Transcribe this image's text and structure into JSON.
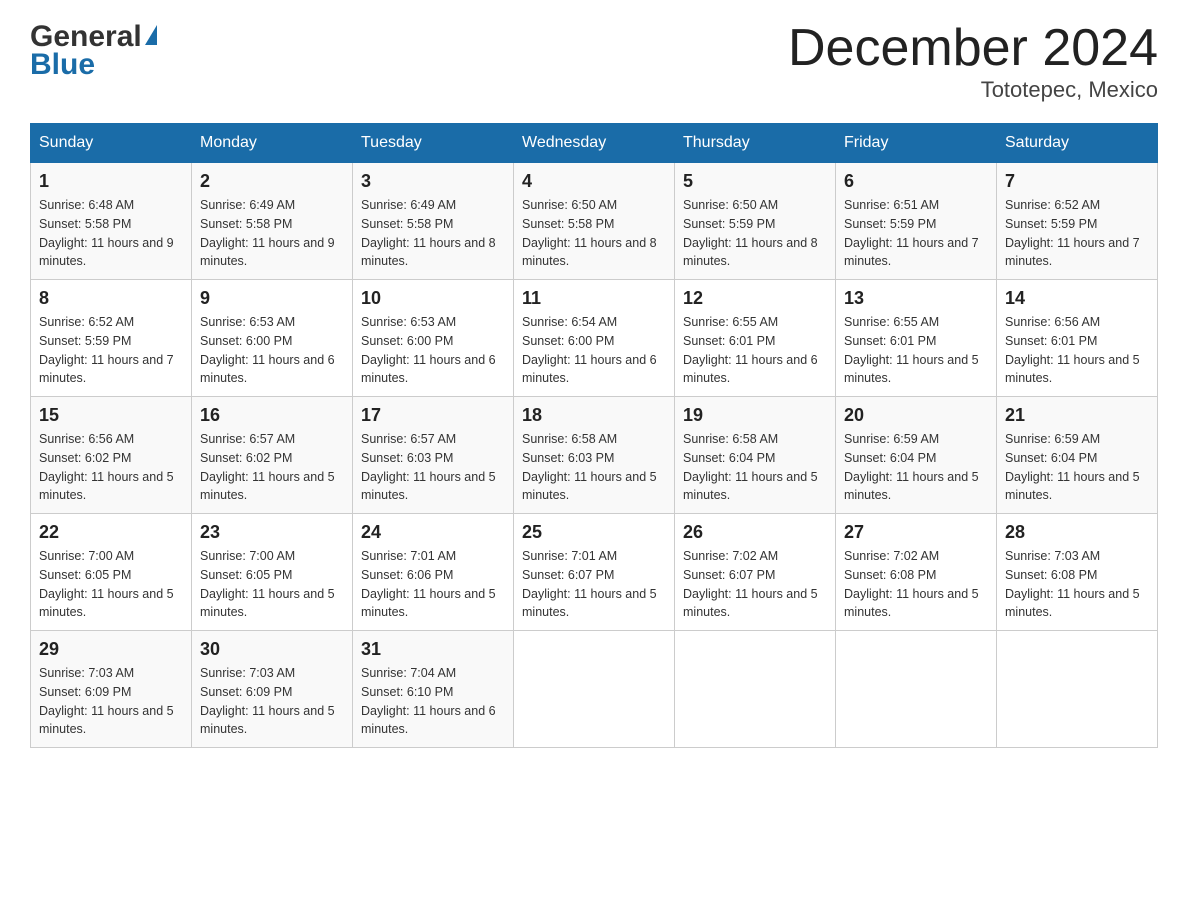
{
  "header": {
    "logo": {
      "top": "General",
      "bottom": "Blue"
    },
    "title": "December 2024",
    "subtitle": "Tototepec, Mexico"
  },
  "days_of_week": [
    "Sunday",
    "Monday",
    "Tuesday",
    "Wednesday",
    "Thursday",
    "Friday",
    "Saturday"
  ],
  "weeks": [
    [
      {
        "date": "1",
        "sunrise": "6:48 AM",
        "sunset": "5:58 PM",
        "daylight": "11 hours and 9 minutes."
      },
      {
        "date": "2",
        "sunrise": "6:49 AM",
        "sunset": "5:58 PM",
        "daylight": "11 hours and 9 minutes."
      },
      {
        "date": "3",
        "sunrise": "6:49 AM",
        "sunset": "5:58 PM",
        "daylight": "11 hours and 8 minutes."
      },
      {
        "date": "4",
        "sunrise": "6:50 AM",
        "sunset": "5:58 PM",
        "daylight": "11 hours and 8 minutes."
      },
      {
        "date": "5",
        "sunrise": "6:50 AM",
        "sunset": "5:59 PM",
        "daylight": "11 hours and 8 minutes."
      },
      {
        "date": "6",
        "sunrise": "6:51 AM",
        "sunset": "5:59 PM",
        "daylight": "11 hours and 7 minutes."
      },
      {
        "date": "7",
        "sunrise": "6:52 AM",
        "sunset": "5:59 PM",
        "daylight": "11 hours and 7 minutes."
      }
    ],
    [
      {
        "date": "8",
        "sunrise": "6:52 AM",
        "sunset": "5:59 PM",
        "daylight": "11 hours and 7 minutes."
      },
      {
        "date": "9",
        "sunrise": "6:53 AM",
        "sunset": "6:00 PM",
        "daylight": "11 hours and 6 minutes."
      },
      {
        "date": "10",
        "sunrise": "6:53 AM",
        "sunset": "6:00 PM",
        "daylight": "11 hours and 6 minutes."
      },
      {
        "date": "11",
        "sunrise": "6:54 AM",
        "sunset": "6:00 PM",
        "daylight": "11 hours and 6 minutes."
      },
      {
        "date": "12",
        "sunrise": "6:55 AM",
        "sunset": "6:01 PM",
        "daylight": "11 hours and 6 minutes."
      },
      {
        "date": "13",
        "sunrise": "6:55 AM",
        "sunset": "6:01 PM",
        "daylight": "11 hours and 5 minutes."
      },
      {
        "date": "14",
        "sunrise": "6:56 AM",
        "sunset": "6:01 PM",
        "daylight": "11 hours and 5 minutes."
      }
    ],
    [
      {
        "date": "15",
        "sunrise": "6:56 AM",
        "sunset": "6:02 PM",
        "daylight": "11 hours and 5 minutes."
      },
      {
        "date": "16",
        "sunrise": "6:57 AM",
        "sunset": "6:02 PM",
        "daylight": "11 hours and 5 minutes."
      },
      {
        "date": "17",
        "sunrise": "6:57 AM",
        "sunset": "6:03 PM",
        "daylight": "11 hours and 5 minutes."
      },
      {
        "date": "18",
        "sunrise": "6:58 AM",
        "sunset": "6:03 PM",
        "daylight": "11 hours and 5 minutes."
      },
      {
        "date": "19",
        "sunrise": "6:58 AM",
        "sunset": "6:04 PM",
        "daylight": "11 hours and 5 minutes."
      },
      {
        "date": "20",
        "sunrise": "6:59 AM",
        "sunset": "6:04 PM",
        "daylight": "11 hours and 5 minutes."
      },
      {
        "date": "21",
        "sunrise": "6:59 AM",
        "sunset": "6:04 PM",
        "daylight": "11 hours and 5 minutes."
      }
    ],
    [
      {
        "date": "22",
        "sunrise": "7:00 AM",
        "sunset": "6:05 PM",
        "daylight": "11 hours and 5 minutes."
      },
      {
        "date": "23",
        "sunrise": "7:00 AM",
        "sunset": "6:05 PM",
        "daylight": "11 hours and 5 minutes."
      },
      {
        "date": "24",
        "sunrise": "7:01 AM",
        "sunset": "6:06 PM",
        "daylight": "11 hours and 5 minutes."
      },
      {
        "date": "25",
        "sunrise": "7:01 AM",
        "sunset": "6:07 PM",
        "daylight": "11 hours and 5 minutes."
      },
      {
        "date": "26",
        "sunrise": "7:02 AM",
        "sunset": "6:07 PM",
        "daylight": "11 hours and 5 minutes."
      },
      {
        "date": "27",
        "sunrise": "7:02 AM",
        "sunset": "6:08 PM",
        "daylight": "11 hours and 5 minutes."
      },
      {
        "date": "28",
        "sunrise": "7:03 AM",
        "sunset": "6:08 PM",
        "daylight": "11 hours and 5 minutes."
      }
    ],
    [
      {
        "date": "29",
        "sunrise": "7:03 AM",
        "sunset": "6:09 PM",
        "daylight": "11 hours and 5 minutes."
      },
      {
        "date": "30",
        "sunrise": "7:03 AM",
        "sunset": "6:09 PM",
        "daylight": "11 hours and 5 minutes."
      },
      {
        "date": "31",
        "sunrise": "7:04 AM",
        "sunset": "6:10 PM",
        "daylight": "11 hours and 6 minutes."
      },
      null,
      null,
      null,
      null
    ]
  ]
}
